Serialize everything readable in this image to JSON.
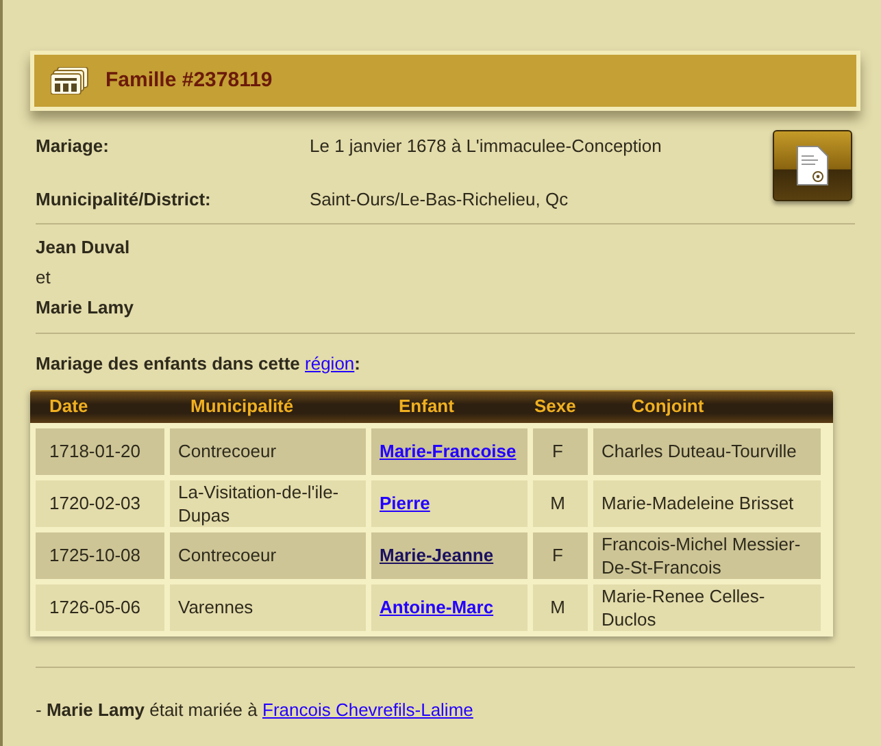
{
  "header": {
    "title": "Famille #2378119"
  },
  "details": [
    {
      "label": "Mariage:",
      "value": "Le 1 janvier 1678 à L'immaculee-Conception"
    },
    {
      "label": "Municipalité/District:",
      "value": "Saint-Ours/Le-Bas-Richelieu, Qc"
    }
  ],
  "couple": {
    "husband": "Jean Duval",
    "conjunction": "et",
    "wife": "Marie Lamy"
  },
  "children_heading": {
    "text": "Mariage des enfants dans cette",
    "link": "région",
    "suffix": ":"
  },
  "table": {
    "columns": [
      "Date",
      "Municipalité",
      "Enfant",
      "Sexe",
      "Conjoint"
    ],
    "rows": [
      {
        "date": "1718-01-20",
        "municipality": "Contrecoeur",
        "child": "Marie-Francoise",
        "visited": false,
        "sex": "F",
        "spouse": "Charles Duteau-Tourville"
      },
      {
        "date": "1720-02-03",
        "municipality": "La-Visitation-de-l'ile-Dupas",
        "child": "Pierre",
        "visited": false,
        "sex": "M",
        "spouse": "Marie-Madeleine Brisset"
      },
      {
        "date": "1725-10-08",
        "municipality": "Contrecoeur",
        "child": "Marie-Jeanne",
        "visited": true,
        "sex": "F",
        "spouse": "Francois-Michel Messier-De-St-Francois"
      },
      {
        "date": "1726-05-06",
        "municipality": "Varennes",
        "child": "Antoine-Marc",
        "visited": false,
        "sex": "M",
        "spouse": "Marie-Renee Celles-Duclos"
      }
    ]
  },
  "note": {
    "text": "- **Marie Lamy** était mariée à",
    "link": "Francois Chevrefils-Lalime"
  }
}
